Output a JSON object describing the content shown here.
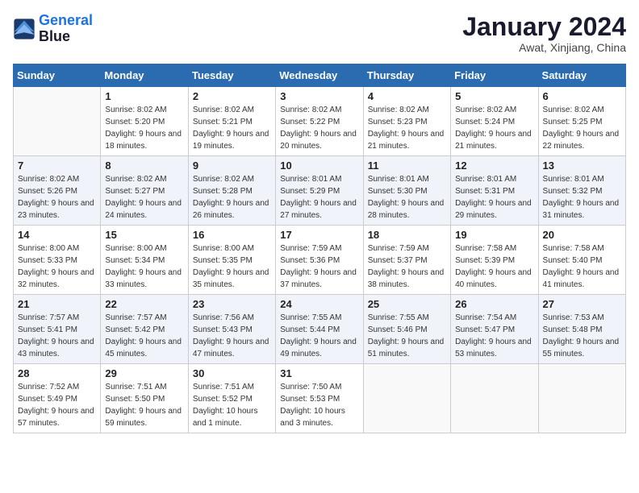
{
  "header": {
    "logo_line1": "General",
    "logo_line2": "Blue",
    "month": "January 2024",
    "location": "Awat, Xinjiang, China"
  },
  "columns": [
    "Sunday",
    "Monday",
    "Tuesday",
    "Wednesday",
    "Thursday",
    "Friday",
    "Saturday"
  ],
  "weeks": [
    [
      {
        "day": "",
        "empty": true
      },
      {
        "day": "1",
        "sunrise": "8:02 AM",
        "sunset": "5:20 PM",
        "daylight": "9 hours and 18 minutes."
      },
      {
        "day": "2",
        "sunrise": "8:02 AM",
        "sunset": "5:21 PM",
        "daylight": "9 hours and 19 minutes."
      },
      {
        "day": "3",
        "sunrise": "8:02 AM",
        "sunset": "5:22 PM",
        "daylight": "9 hours and 20 minutes."
      },
      {
        "day": "4",
        "sunrise": "8:02 AM",
        "sunset": "5:23 PM",
        "daylight": "9 hours and 21 minutes."
      },
      {
        "day": "5",
        "sunrise": "8:02 AM",
        "sunset": "5:24 PM",
        "daylight": "9 hours and 21 minutes."
      },
      {
        "day": "6",
        "sunrise": "8:02 AM",
        "sunset": "5:25 PM",
        "daylight": "9 hours and 22 minutes."
      }
    ],
    [
      {
        "day": "7",
        "sunrise": "8:02 AM",
        "sunset": "5:26 PM",
        "daylight": "9 hours and 23 minutes."
      },
      {
        "day": "8",
        "sunrise": "8:02 AM",
        "sunset": "5:27 PM",
        "daylight": "9 hours and 24 minutes."
      },
      {
        "day": "9",
        "sunrise": "8:02 AM",
        "sunset": "5:28 PM",
        "daylight": "9 hours and 26 minutes."
      },
      {
        "day": "10",
        "sunrise": "8:01 AM",
        "sunset": "5:29 PM",
        "daylight": "9 hours and 27 minutes."
      },
      {
        "day": "11",
        "sunrise": "8:01 AM",
        "sunset": "5:30 PM",
        "daylight": "9 hours and 28 minutes."
      },
      {
        "day": "12",
        "sunrise": "8:01 AM",
        "sunset": "5:31 PM",
        "daylight": "9 hours and 29 minutes."
      },
      {
        "day": "13",
        "sunrise": "8:01 AM",
        "sunset": "5:32 PM",
        "daylight": "9 hours and 31 minutes."
      }
    ],
    [
      {
        "day": "14",
        "sunrise": "8:00 AM",
        "sunset": "5:33 PM",
        "daylight": "9 hours and 32 minutes."
      },
      {
        "day": "15",
        "sunrise": "8:00 AM",
        "sunset": "5:34 PM",
        "daylight": "9 hours and 33 minutes."
      },
      {
        "day": "16",
        "sunrise": "8:00 AM",
        "sunset": "5:35 PM",
        "daylight": "9 hours and 35 minutes."
      },
      {
        "day": "17",
        "sunrise": "7:59 AM",
        "sunset": "5:36 PM",
        "daylight": "9 hours and 37 minutes."
      },
      {
        "day": "18",
        "sunrise": "7:59 AM",
        "sunset": "5:37 PM",
        "daylight": "9 hours and 38 minutes."
      },
      {
        "day": "19",
        "sunrise": "7:58 AM",
        "sunset": "5:39 PM",
        "daylight": "9 hours and 40 minutes."
      },
      {
        "day": "20",
        "sunrise": "7:58 AM",
        "sunset": "5:40 PM",
        "daylight": "9 hours and 41 minutes."
      }
    ],
    [
      {
        "day": "21",
        "sunrise": "7:57 AM",
        "sunset": "5:41 PM",
        "daylight": "9 hours and 43 minutes."
      },
      {
        "day": "22",
        "sunrise": "7:57 AM",
        "sunset": "5:42 PM",
        "daylight": "9 hours and 45 minutes."
      },
      {
        "day": "23",
        "sunrise": "7:56 AM",
        "sunset": "5:43 PM",
        "daylight": "9 hours and 47 minutes."
      },
      {
        "day": "24",
        "sunrise": "7:55 AM",
        "sunset": "5:44 PM",
        "daylight": "9 hours and 49 minutes."
      },
      {
        "day": "25",
        "sunrise": "7:55 AM",
        "sunset": "5:46 PM",
        "daylight": "9 hours and 51 minutes."
      },
      {
        "day": "26",
        "sunrise": "7:54 AM",
        "sunset": "5:47 PM",
        "daylight": "9 hours and 53 minutes."
      },
      {
        "day": "27",
        "sunrise": "7:53 AM",
        "sunset": "5:48 PM",
        "daylight": "9 hours and 55 minutes."
      }
    ],
    [
      {
        "day": "28",
        "sunrise": "7:52 AM",
        "sunset": "5:49 PM",
        "daylight": "9 hours and 57 minutes."
      },
      {
        "day": "29",
        "sunrise": "7:51 AM",
        "sunset": "5:50 PM",
        "daylight": "9 hours and 59 minutes."
      },
      {
        "day": "30",
        "sunrise": "7:51 AM",
        "sunset": "5:52 PM",
        "daylight": "10 hours and 1 minute."
      },
      {
        "day": "31",
        "sunrise": "7:50 AM",
        "sunset": "5:53 PM",
        "daylight": "10 hours and 3 minutes."
      },
      {
        "day": "",
        "empty": true
      },
      {
        "day": "",
        "empty": true
      },
      {
        "day": "",
        "empty": true
      }
    ]
  ],
  "labels": {
    "sunrise": "Sunrise:",
    "sunset": "Sunset:",
    "daylight": "Daylight:"
  }
}
